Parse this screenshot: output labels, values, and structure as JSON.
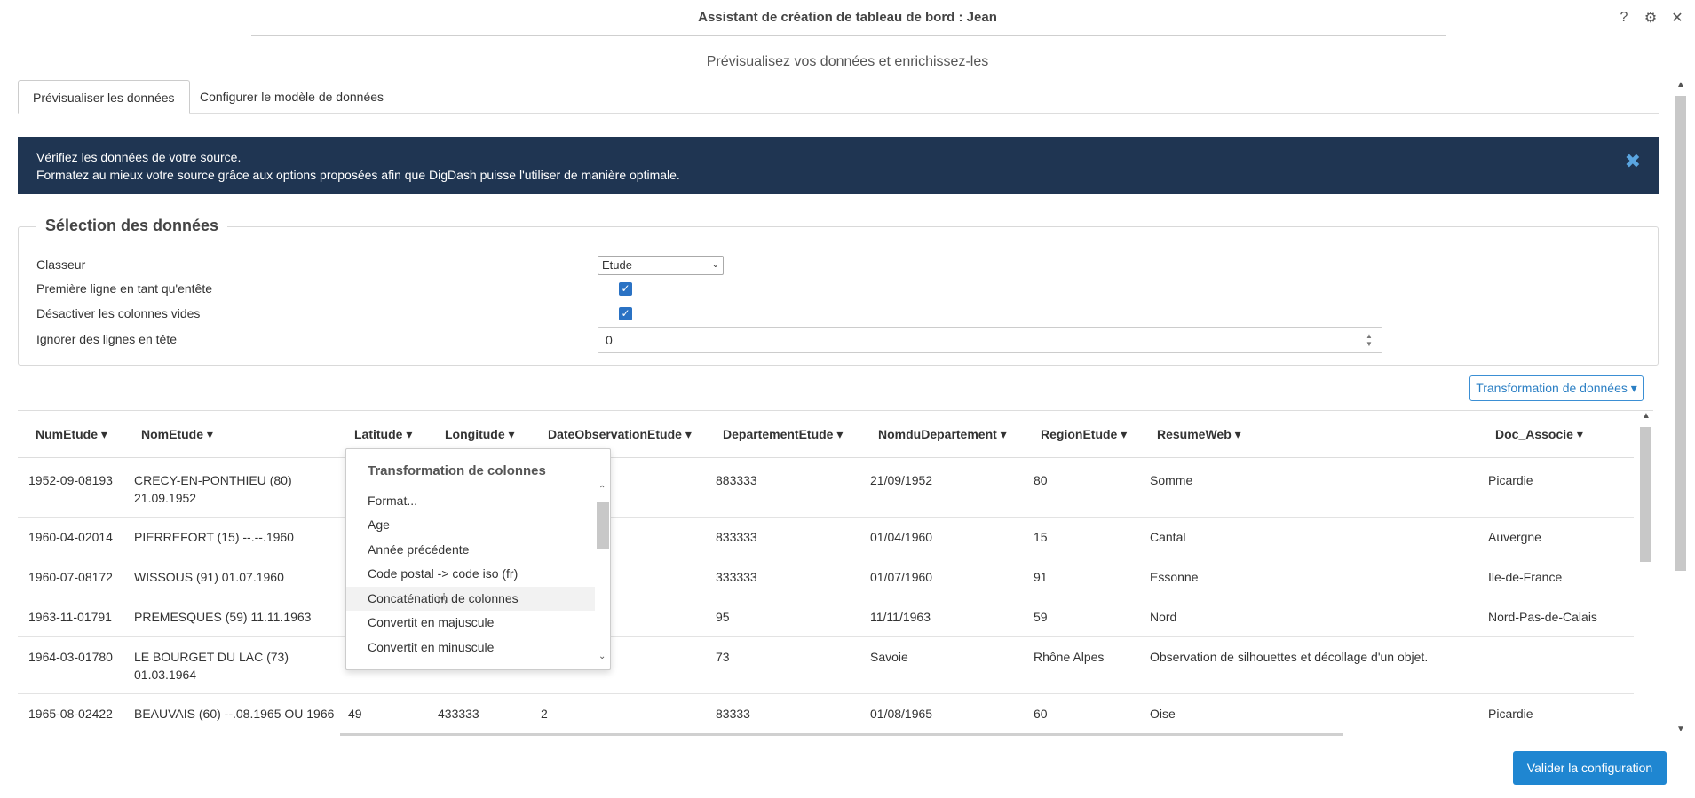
{
  "header": {
    "title": "Assistant de création de tableau de bord : Jean",
    "icons": [
      "help-icon",
      "gear-icon",
      "close-icon"
    ],
    "icon_glyphs": {
      "help": "?",
      "gear": "⚙",
      "close": "✕"
    }
  },
  "subtitle": "Prévisualisez vos données et enrichissez-les",
  "tabs": [
    {
      "label": "Prévisualiser les données",
      "active": true
    },
    {
      "label": "Configurer le modèle de données",
      "active": false
    }
  ],
  "banner": {
    "line1": "Vérifiez les données de votre source.",
    "line2": "Formatez au mieux votre source grâce aux options proposées afin que DigDash puisse l'utiliser de manière optimale.",
    "close_glyph": "✖",
    "bg_color": "#1f3552"
  },
  "selection": {
    "legend": "Sélection des données",
    "classeur_label": "Classeur",
    "classeur_value": "Etude",
    "first_row_header_label": "Première ligne en tant qu'entête",
    "first_row_header_checked": true,
    "disable_empty_cols_label": "Désactiver les colonnes vides",
    "disable_empty_cols_checked": true,
    "ignore_rows_label": "Ignorer des lignes en tête",
    "ignore_rows_value": "0"
  },
  "transform_button": "Transformation de données ▾",
  "table": {
    "columns": [
      "NumEtude",
      "NomEtude",
      "Latitude",
      "Longitude",
      "DateObservationEtude",
      "DepartementEtude",
      "NomduDepartement",
      "RegionEtude",
      "ResumeWeb",
      "Doc_Associe"
    ],
    "rows": [
      {
        "num": "1952-09-08193",
        "nom1": "CRECY-EN-PONTHIEU (80)",
        "nom2": "21.09.1952",
        "c5": "883333",
        "c6": "21/09/1952",
        "c7": "80",
        "c8": "Somme",
        "c9": "",
        "c10": "Picardie"
      },
      {
        "num": "1960-04-02014",
        "nom1": "PIERREFORT (15) --.--.1960",
        "nom2": "",
        "c5": "833333",
        "c6": "01/04/1960",
        "c7": "15",
        "c8": "Cantal",
        "c9": "",
        "c10": "Auvergne"
      },
      {
        "num": "1960-07-08172",
        "nom1": "WISSOUS (91) 01.07.1960",
        "nom2": "",
        "c5": "333333",
        "c6": "01/07/1960",
        "c7": "91",
        "c8": "Essonne",
        "c9": "",
        "c10": "Ile-de-France"
      },
      {
        "num": "1963-11-01791",
        "nom1": "PREMESQUES (59) 11.11.1963",
        "nom2": "",
        "c5": "95",
        "c6": "11/11/1963",
        "c7": "59",
        "c8": "Nord",
        "c9": "",
        "c10": "Nord-Pas-de-Calais"
      },
      {
        "num": "1964-03-01780",
        "nom1": "LE BOURGET DU LAC (73)",
        "nom2": "01.03.1964",
        "c5": "73",
        "c6": "Savoie",
        "c7": "Rhône Alpes",
        "c8": "Observation de silhouettes et décollage d'un objet.",
        "c9": "",
        "c10": ""
      },
      {
        "num": "1965-08-02422",
        "nom1": "BEAUVAIS (60) --.08.1965 OU 1966",
        "nom2": "",
        "lat": "49",
        "lon": "433333",
        "dob": "2",
        "c5": "83333",
        "c6": "01/08/1965",
        "c7": "60",
        "c8": "Oise",
        "c9": "",
        "c10": "Picardie"
      }
    ]
  },
  "dropdown": {
    "title": "Transformation de colonnes",
    "items": [
      "Format...",
      "Age",
      "Année précédente",
      "Code postal -> code iso (fr)",
      "Concaténation de colonnes",
      "Convertit en majuscule",
      "Convertit en minuscule"
    ],
    "hovered": "Concaténation de colonnes"
  },
  "validate_button": "Valider la configuration"
}
